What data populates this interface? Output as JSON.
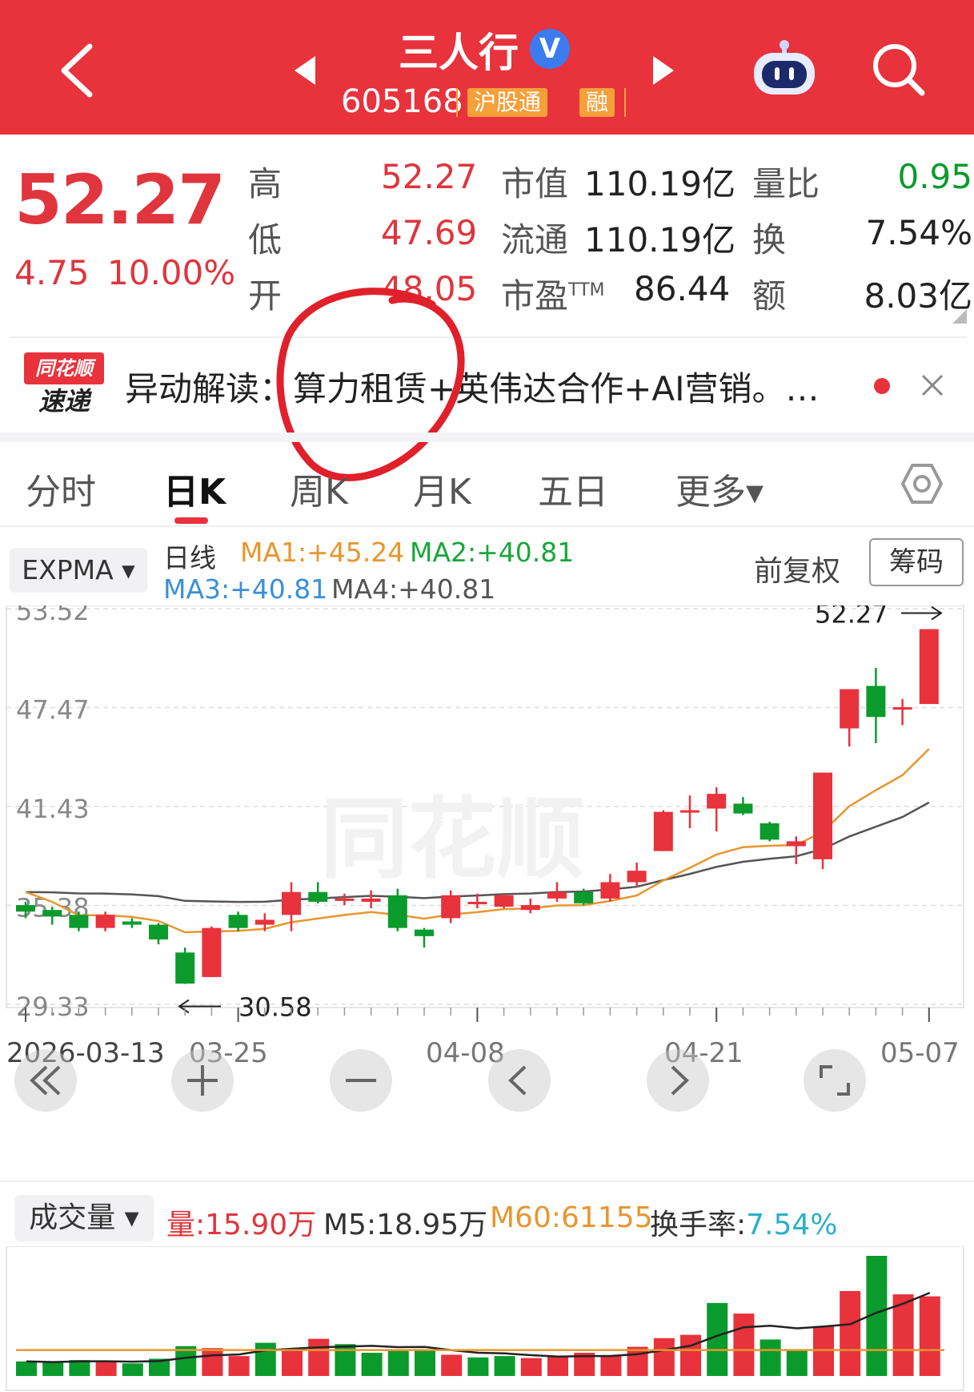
{
  "header": {
    "stock_name": "三人行",
    "verified_badge": "V",
    "stock_code": "605168",
    "tag_hgt": "沪股通",
    "tag_margin": "融",
    "icons": {
      "back": "chevron-left-icon",
      "prev": "triangle-left-icon",
      "next": "triangle-right-icon",
      "robot": "robot-assistant-icon",
      "search": "search-icon"
    }
  },
  "quote": {
    "price": "52.27",
    "change": "4.75",
    "change_pct": "10.00%",
    "high_label": "高",
    "high_value": "52.27",
    "low_label": "低",
    "low_value": "47.69",
    "open_label": "开",
    "open_value": "48.05",
    "mcap_label": "市值",
    "mcap_value": "110.19亿",
    "float_label": "流通",
    "float_value": "110.19亿",
    "pe_label": "市盈",
    "pe_sup": "TTM",
    "pe_value": "86.44",
    "volratio_label": "量比",
    "volratio_value": "0.95",
    "turnover_label": "换",
    "turnover_value": "7.54%",
    "amount_label": "额",
    "amount_value": "8.03亿"
  },
  "news": {
    "logo_top": "同花顺",
    "logo_bottom": "速递",
    "prefix": "异动解读：",
    "text": "算力租赁+英伟达合作+AI营销。…"
  },
  "tabs": [
    "分时",
    "日K",
    "周K",
    "月K",
    "五日",
    "更多▾"
  ],
  "active_tab": "日K",
  "indicator_bar": {
    "selector": "EXPMA ▾",
    "line_label": "日线",
    "ma1": "MA1:+45.24",
    "ma2": "MA2:+40.81",
    "ma3": "MA3:+40.81",
    "ma4": "MA4:+40.81",
    "adjust": "前复权",
    "chips": "筹码"
  },
  "chart_data": {
    "type": "candlestick",
    "y_ticks": [
      "53.52",
      "47.47",
      "41.43",
      "35.38",
      "29.33"
    ],
    "x_ticks": [
      "2026-03-13",
      "03-25",
      "04-08",
      "04-21",
      "05-07"
    ],
    "annotations": {
      "max": "52.27",
      "min": "30.58"
    },
    "candles": [
      {
        "o": 35.4,
        "c": 35.0,
        "h": 35.6,
        "l": 34.6
      },
      {
        "o": 35.1,
        "c": 34.7,
        "h": 35.3,
        "l": 34.2
      },
      {
        "o": 34.8,
        "c": 34.0,
        "h": 35.0,
        "l": 33.8
      },
      {
        "o": 34.0,
        "c": 34.8,
        "h": 35.0,
        "l": 33.8
      },
      {
        "o": 34.4,
        "c": 34.2,
        "h": 34.6,
        "l": 34.0
      },
      {
        "o": 34.2,
        "c": 33.3,
        "h": 34.3,
        "l": 33.0
      },
      {
        "o": 32.5,
        "c": 30.6,
        "h": 32.8,
        "l": 30.58
      },
      {
        "o": 31.0,
        "c": 34.0,
        "h": 34.1,
        "l": 31.0
      },
      {
        "o": 34.8,
        "c": 34.0,
        "h": 35.0,
        "l": 33.8
      },
      {
        "o": 34.2,
        "c": 34.5,
        "h": 34.9,
        "l": 33.8
      },
      {
        "o": 34.8,
        "c": 36.2,
        "h": 36.8,
        "l": 33.8
      },
      {
        "o": 36.2,
        "c": 35.6,
        "h": 36.8,
        "l": 35.5
      },
      {
        "o": 35.8,
        "c": 35.8,
        "h": 36.1,
        "l": 35.4
      },
      {
        "o": 35.6,
        "c": 35.8,
        "h": 36.3,
        "l": 35.2
      },
      {
        "o": 36.0,
        "c": 34.0,
        "h": 36.4,
        "l": 33.8
      },
      {
        "o": 33.9,
        "c": 33.5,
        "h": 34.0,
        "l": 32.8
      },
      {
        "o": 34.6,
        "c": 36.0,
        "h": 36.3,
        "l": 34.3
      },
      {
        "o": 35.6,
        "c": 35.6,
        "h": 36.1,
        "l": 35.2
      },
      {
        "o": 35.3,
        "c": 36.0,
        "h": 36.1,
        "l": 35.2
      },
      {
        "o": 35.1,
        "c": 35.4,
        "h": 35.8,
        "l": 34.9
      },
      {
        "o": 35.8,
        "c": 36.2,
        "h": 36.8,
        "l": 35.6
      },
      {
        "o": 36.2,
        "c": 35.5,
        "h": 36.4,
        "l": 35.4
      },
      {
        "o": 35.8,
        "c": 36.8,
        "h": 37.3,
        "l": 35.6
      },
      {
        "o": 36.8,
        "c": 37.5,
        "h": 38.0,
        "l": 36.5
      },
      {
        "o": 38.7,
        "c": 41.1,
        "h": 41.2,
        "l": 38.7
      },
      {
        "o": 41.2,
        "c": 41.2,
        "h": 42.1,
        "l": 40.1
      },
      {
        "o": 41.3,
        "c": 42.2,
        "h": 42.6,
        "l": 39.9
      },
      {
        "o": 41.6,
        "c": 41.0,
        "h": 42.0,
        "l": 40.9
      },
      {
        "o": 40.4,
        "c": 39.4,
        "h": 40.5,
        "l": 39.3
      },
      {
        "o": 39.0,
        "c": 39.3,
        "h": 39.6,
        "l": 37.9
      },
      {
        "o": 38.2,
        "c": 43.5,
        "h": 43.5,
        "l": 37.6
      },
      {
        "o": 46.2,
        "c": 48.6,
        "h": 48.6,
        "l": 45.1
      },
      {
        "o": 48.8,
        "c": 46.9,
        "h": 49.9,
        "l": 45.3
      },
      {
        "o": 47.4,
        "c": 47.5,
        "h": 48.0,
        "l": 46.4
      },
      {
        "o": 47.69,
        "c": 52.27,
        "h": 52.27,
        "l": 47.69
      }
    ],
    "volume": {
      "selector": "成交量 ▾",
      "vol": "量:15.90万",
      "m5": "M5:18.95万",
      "m60": "M60:61155",
      "turnover": "换手率:7.54%",
      "bars": [
        {
          "v": 2.2,
          "up": false
        },
        {
          "v": 2.0,
          "up": false
        },
        {
          "v": 2.4,
          "up": false
        },
        {
          "v": 2.3,
          "up": true
        },
        {
          "v": 1.9,
          "up": false
        },
        {
          "v": 2.6,
          "up": false
        },
        {
          "v": 4.5,
          "up": false
        },
        {
          "v": 4.2,
          "up": true
        },
        {
          "v": 3.0,
          "up": true
        },
        {
          "v": 5.0,
          "up": false
        },
        {
          "v": 3.8,
          "up": true
        },
        {
          "v": 5.6,
          "up": true
        },
        {
          "v": 4.8,
          "up": false
        },
        {
          "v": 3.5,
          "up": false
        },
        {
          "v": 4.0,
          "up": false
        },
        {
          "v": 4.0,
          "up": false
        },
        {
          "v": 3.2,
          "up": true
        },
        {
          "v": 2.8,
          "up": false
        },
        {
          "v": 3.0,
          "up": false
        },
        {
          "v": 2.7,
          "up": true
        },
        {
          "v": 2.9,
          "up": true
        },
        {
          "v": 3.5,
          "up": true
        },
        {
          "v": 3.0,
          "up": true
        },
        {
          "v": 4.4,
          "up": true
        },
        {
          "v": 5.7,
          "up": true
        },
        {
          "v": 6.2,
          "up": true
        },
        {
          "v": 11.0,
          "up": false
        },
        {
          "v": 9.4,
          "up": true
        },
        {
          "v": 5.5,
          "up": false
        },
        {
          "v": 3.8,
          "up": false
        },
        {
          "v": 7.5,
          "up": true
        },
        {
          "v": 12.8,
          "up": true
        },
        {
          "v": 18.1,
          "up": false
        },
        {
          "v": 12.3,
          "up": true
        },
        {
          "v": 12.0,
          "up": true
        }
      ]
    }
  }
}
